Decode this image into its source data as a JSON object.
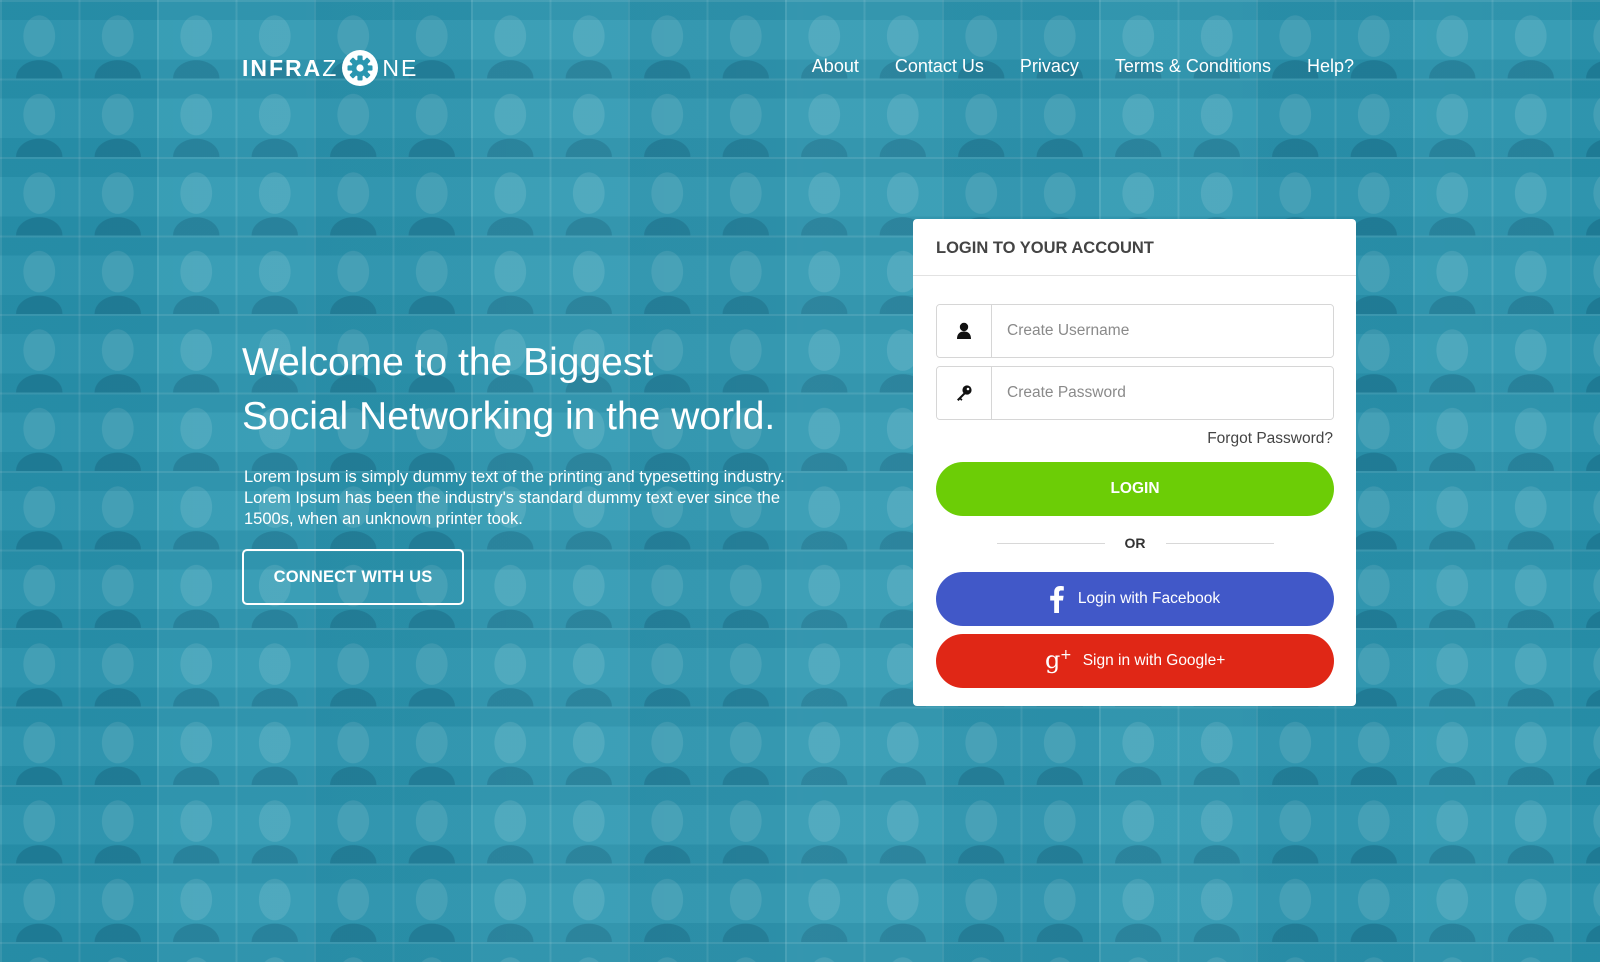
{
  "brand": {
    "logo_left": "INFRA",
    "logo_mid": "Z",
    "logo_right": "NE"
  },
  "nav": {
    "items": [
      {
        "label": "About"
      },
      {
        "label": "Contact Us"
      },
      {
        "label": "Privacy"
      },
      {
        "label": "Terms & Conditions"
      },
      {
        "label": "Help?"
      }
    ]
  },
  "hero": {
    "title_line1": "Welcome to the Biggest",
    "title_line2": "Social Networking in the world.",
    "description": "Lorem Ipsum is simply dummy text of the printing and typesetting industry. Lorem Ipsum has been the industry's standard dummy text ever since the 1500s, when an unknown printer took.",
    "cta_label": "CONNECT WITH US"
  },
  "login": {
    "heading": "LOGIN TO YOUR ACCOUNT",
    "username_placeholder": "Create Username",
    "password_placeholder": "Create Password",
    "forgot_label": "Forgot Password?",
    "login_label": "LOGIN",
    "or_label": "OR",
    "facebook_label": "Login with Facebook",
    "google_label": "Sign in with Google+"
  },
  "icons": {
    "logo_gear": "gear-icon",
    "username": "user-icon",
    "password": "key-icon",
    "facebook": "facebook-icon",
    "google": "google-plus-icon"
  },
  "colors": {
    "background": "#2a96b0",
    "login_button": "#6ccd06",
    "facebook_button": "#4158c8",
    "google_button": "#e02716",
    "card": "#ffffff"
  }
}
